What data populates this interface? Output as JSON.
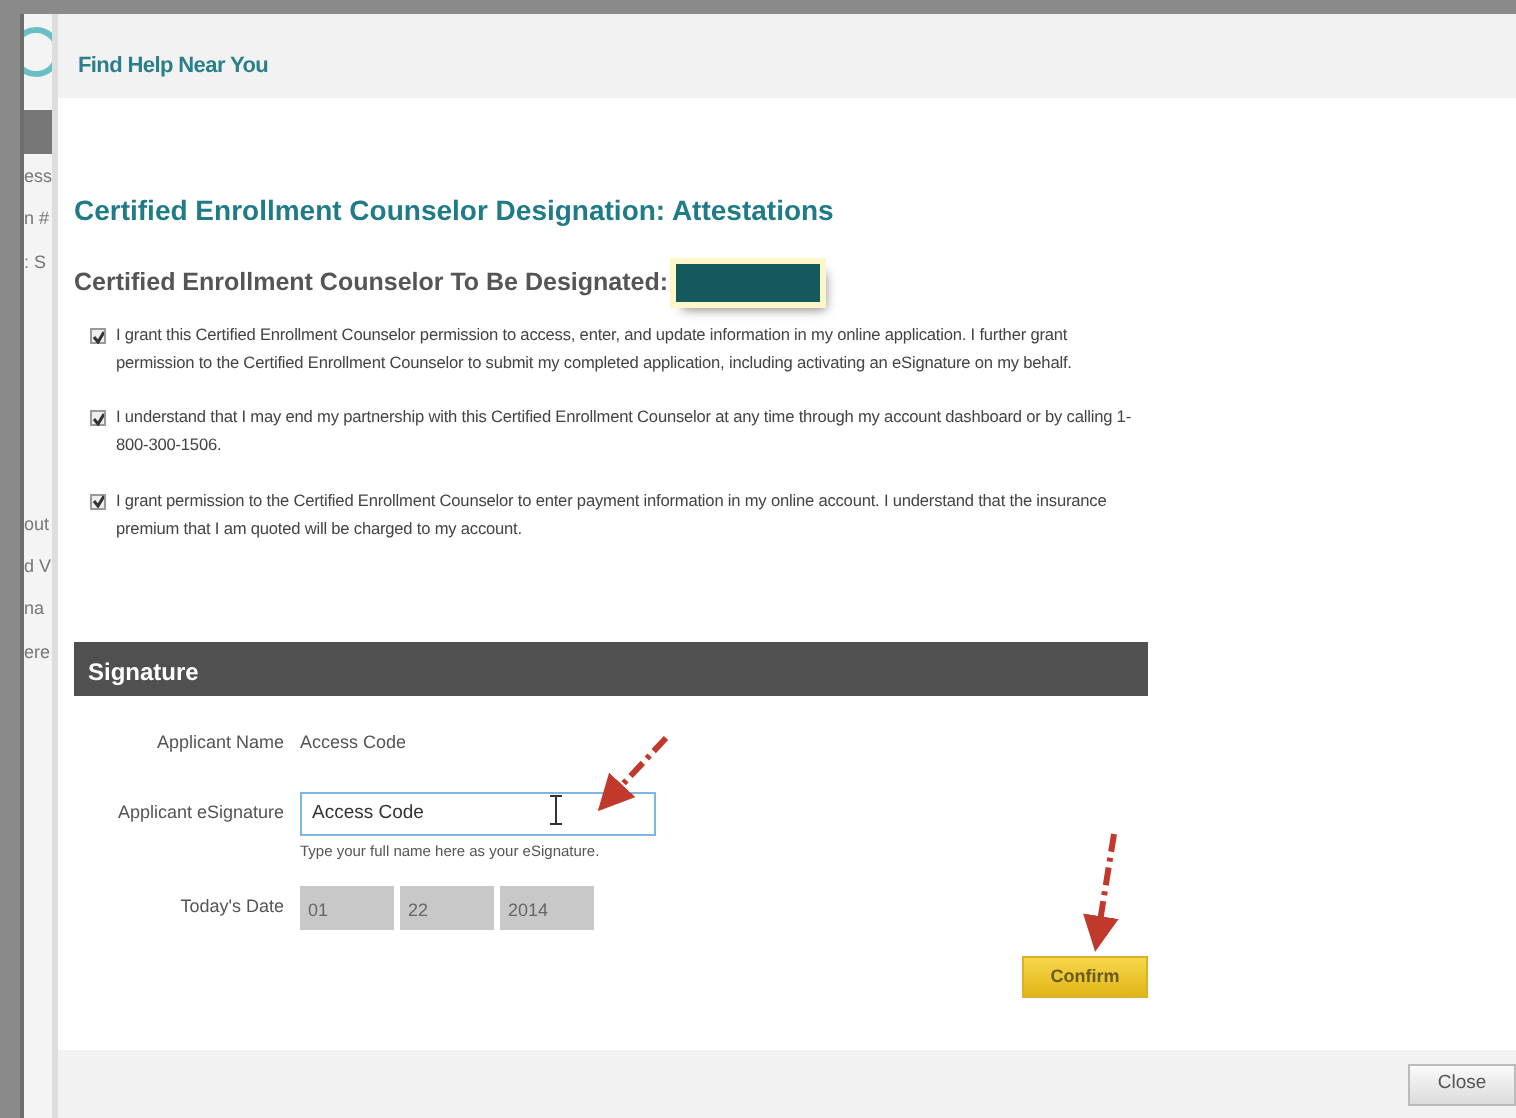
{
  "background_fragments": [
    "ess",
    "n #",
    ": S",
    "out",
    "d V",
    "na",
    "ere"
  ],
  "dialog": {
    "title": "Find Help Near You"
  },
  "heading": "Certified Enrollment Counselor Designation: Attestations",
  "designee_label": "Certified Enrollment Counselor To Be Designated:",
  "attestations": [
    {
      "checked": true,
      "text": "I grant this Certified Enrollment Counselor permission to access, enter, and update information in my online application. I further grant permission to the Certified Enrollment Counselor to submit my completed application, including activating an eSignature on my behalf."
    },
    {
      "checked": true,
      "text": "I understand that I may end my partnership with this Certified Enrollment Counselor at any time through my account dashboard or by calling 1-800-300-1506."
    },
    {
      "checked": true,
      "text": "I grant permission to the Certified Enrollment Counselor to enter payment information in my online account. I understand that the insurance premium that I am quoted will be charged to my account."
    }
  ],
  "signature": {
    "title": "Signature",
    "applicant_name_label": "Applicant Name",
    "applicant_name": "Access Code",
    "esignature_label": "Applicant eSignature",
    "esignature_value": "Access Code",
    "esignature_hint": "Type your full name here as your eSignature.",
    "date_label": "Today's Date",
    "date_parts": [
      "01",
      "22",
      "2014"
    ]
  },
  "confirm_button": "Confirm",
  "close_button": "Close"
}
